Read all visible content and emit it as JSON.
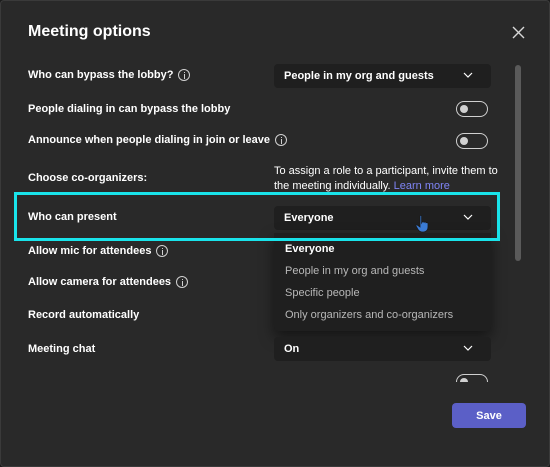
{
  "dialog": {
    "title": "Meeting options",
    "close_icon": "close-icon"
  },
  "options": {
    "bypass_lobby": {
      "label": "Who can bypass the lobby?",
      "value": "People in my org and guests"
    },
    "dial_in_bypass": {
      "label": "People dialing in can bypass the lobby",
      "state": "off"
    },
    "announce_dial_in": {
      "label": "Announce when people dialing in join or leave",
      "state": "off"
    },
    "co_organizers": {
      "label": "Choose co-organizers:",
      "note": "To assign a role to a participant, invite them to the meeting individually.",
      "link": "Learn more"
    },
    "who_can_present": {
      "label": "Who can present",
      "value": "Everyone",
      "options": [
        "Everyone",
        "People in my org and guests",
        "Specific people",
        "Only organizers and co-organizers"
      ]
    },
    "allow_mic": {
      "label": "Allow mic for attendees"
    },
    "allow_camera": {
      "label": "Allow camera for attendees"
    },
    "record_auto": {
      "label": "Record automatically"
    },
    "meeting_chat": {
      "label": "Meeting chat",
      "value": "On"
    }
  },
  "footer": {
    "save_label": "Save"
  },
  "colors": {
    "accent": "#5b5fc7",
    "highlight": "#19e3ea",
    "link": "#7f85f5"
  }
}
